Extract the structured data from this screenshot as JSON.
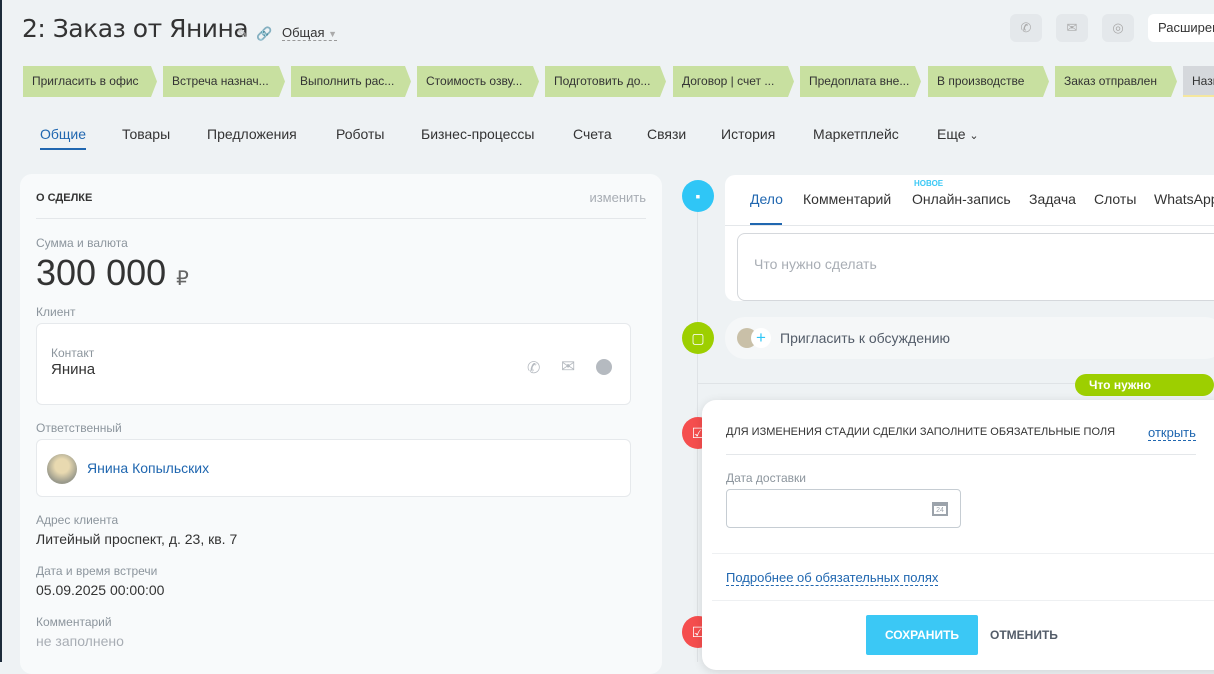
{
  "header": {
    "title": "2: Заказ от Янина",
    "category": "Общая",
    "extended_label": "Расширен"
  },
  "stages": [
    "Пригласить в офис",
    "Встреча назнач...",
    "Выполнить рас...",
    "Стоимость озву...",
    "Подготовить до...",
    "Договор | счет ...",
    "Предоплата вне...",
    "В производстве",
    "Заказ отправлен",
    "Назн"
  ],
  "tabs": [
    "Общие",
    "Товары",
    "Предложения",
    "Роботы",
    "Бизнес-процессы",
    "Счета",
    "Связи",
    "История",
    "Маркетплейс",
    "Еще"
  ],
  "deal": {
    "section_title": "О СДЕЛКЕ",
    "edit_label": "изменить",
    "amount_label": "Сумма и валюта",
    "amount": "300 000",
    "currency": "₽",
    "client_label": "Клиент",
    "contact_label": "Контакт",
    "contact_name": "Янина",
    "responsible_label": "Ответственный",
    "responsible_name": "Янина Копыльских",
    "address_label": "Адрес клиента",
    "address": "Литейный проспект, д. 23, кв. 7",
    "meeting_label": "Дата и время встречи",
    "meeting": "05.09.2025 00:00:00",
    "comment_label": "Комментарий",
    "comment": "не заполнено"
  },
  "activity": {
    "tabs": [
      "Дело",
      "Комментарий",
      "Онлайн-запись",
      "Задача",
      "Слоты",
      "WhatsApp"
    ],
    "new_badge": "НОВОЕ",
    "placeholder": "Что нужно сделать",
    "invite_label": "Пригласить к обсуждению",
    "todo_badge": "Что нужно сделать"
  },
  "popup": {
    "title": "ДЛЯ ИЗМЕНЕНИЯ СТАДИИ СДЕЛКИ ЗАПОЛНИТЕ ОБЯЗАТЕЛЬНЫЕ ПОЛЯ",
    "open_label": "открыть",
    "field_label": "Дата доставки",
    "field_value": "",
    "calendar_day": "24",
    "more_link": "Подробнее об обязательных полях",
    "save": "СОХРАНИТЬ",
    "cancel": "ОТМЕНИТЬ"
  }
}
